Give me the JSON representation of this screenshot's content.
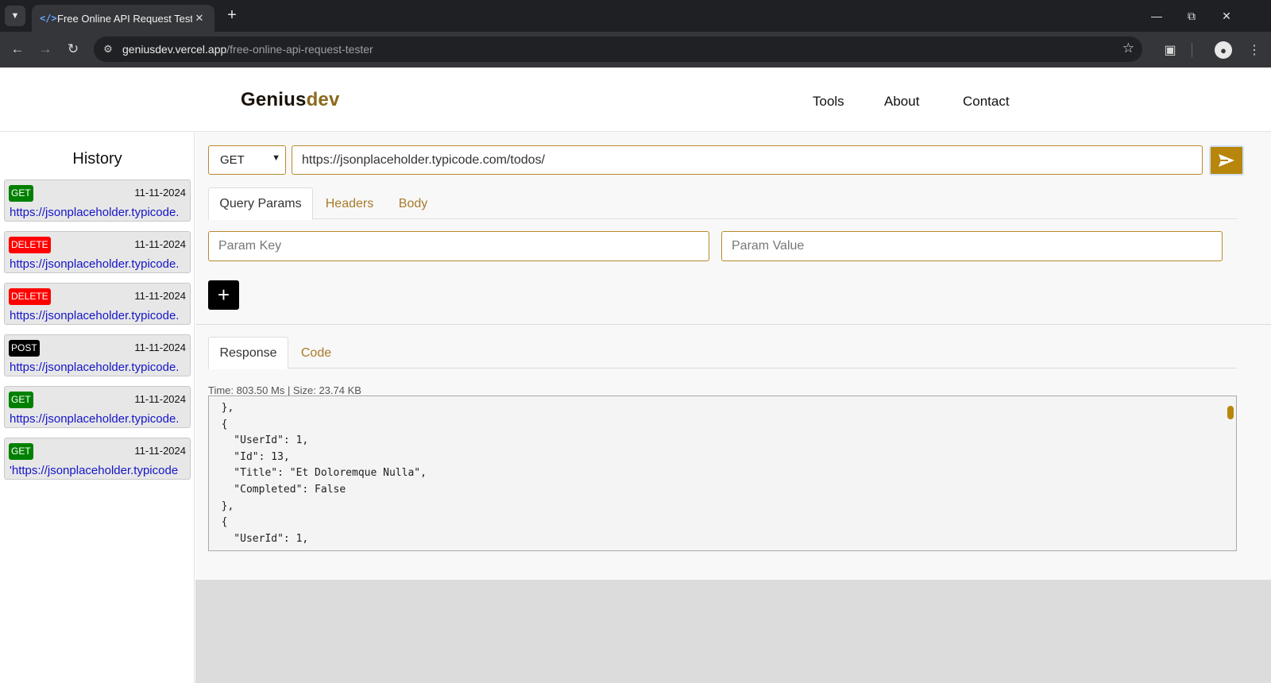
{
  "browser": {
    "tab_title": "Free Online API Request Tester",
    "tab_favicon": "</>",
    "url_host": "geniusdev.vercel.app",
    "url_path": "/free-online-api-request-tester"
  },
  "header": {
    "logo_part1": "Genius",
    "logo_part2": "dev",
    "nav": [
      "Tools",
      "About",
      "Contact"
    ]
  },
  "history": {
    "title": "History",
    "items": [
      {
        "method": "GET",
        "date": "11-11-2024",
        "url": "https://jsonplaceholder.typicode.",
        "color": "#008000"
      },
      {
        "method": "DELETE",
        "date": "11-11-2024",
        "url": "https://jsonplaceholder.typicode.",
        "color": "#ff0000"
      },
      {
        "method": "DELETE",
        "date": "11-11-2024",
        "url": "https://jsonplaceholder.typicode.",
        "color": "#ff0000"
      },
      {
        "method": "POST",
        "date": "11-11-2024",
        "url": "https://jsonplaceholder.typicode.",
        "color": "#000000"
      },
      {
        "method": "GET",
        "date": "11-11-2024",
        "url": "https://jsonplaceholder.typicode.",
        "color": "#008000"
      },
      {
        "method": "GET",
        "date": "11-11-2024",
        "url": "'https://jsonplaceholder.typicode",
        "color": "#008000"
      }
    ]
  },
  "request": {
    "method": "GET",
    "url": "https://jsonplaceholder.typicode.com/todos/",
    "tabs": [
      "Query Params",
      "Headers",
      "Body"
    ],
    "param_key_placeholder": "Param Key",
    "param_value_placeholder": "Param Value",
    "add_label": "+"
  },
  "response": {
    "tabs": [
      "Response",
      "Code"
    ],
    "meta": "Time: 803.50 Ms | Size: 23.74 KB",
    "lines": [
      "  },",
      "  {",
      "    \"UserId\": 1,",
      "    \"Id\": 13,",
      "    \"Title\": \"Et Doloremque Nulla\",",
      "    \"Completed\": False",
      "  },",
      "  {",
      "    \"UserId\": 1,"
    ]
  },
  "colors": {
    "accent": "#b8860b",
    "get": "#008000",
    "delete": "#ff0000",
    "post": "#000000",
    "link": "#1515c8"
  }
}
